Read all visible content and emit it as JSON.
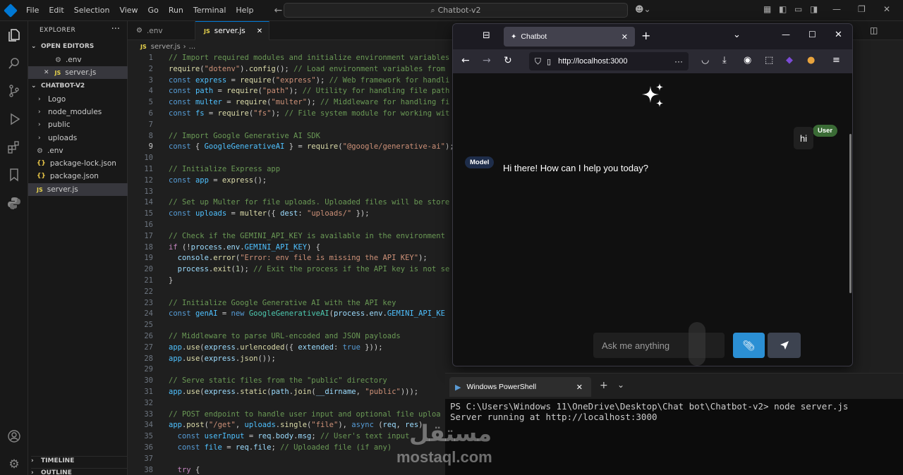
{
  "titlebar": {
    "menus": [
      "File",
      "Edit",
      "Selection",
      "View",
      "Go",
      "Run",
      "Terminal",
      "Help"
    ],
    "search": "Chatbot-v2"
  },
  "sidebar": {
    "title": "EXPLORER",
    "open_editors_label": "OPEN EDITORS",
    "open_editors": [
      ".env",
      "server.js"
    ],
    "project_label": "CHATBOT-V2",
    "folders": [
      "Logo",
      "node_modules",
      "public",
      "uploads"
    ],
    "files": [
      ".env",
      "package-lock.json",
      "package.json",
      "server.js"
    ],
    "timeline_label": "TIMELINE",
    "outline_label": "OUTLINE"
  },
  "editor": {
    "tabs": [
      ".env",
      "server.js"
    ],
    "breadcrumb_file": "server.js",
    "breadcrumb_more": "...",
    "line_numbers": [
      "1",
      "2",
      "3",
      "4",
      "5",
      "6",
      "7",
      "8",
      "9",
      "10",
      "11",
      "12",
      "13",
      "14",
      "15",
      "16",
      "17",
      "18",
      "19",
      "20",
      "21",
      "22",
      "23",
      "24",
      "25",
      "26",
      "27",
      "28",
      "29",
      "30",
      "31",
      "32",
      "33",
      "34",
      "35",
      "36",
      "37",
      "38"
    ]
  },
  "browser": {
    "tab_title": "Chatbot",
    "url": "http://localhost:3000",
    "user_badge": "User",
    "user_message": "hi",
    "model_badge": "Model",
    "model_message": "Hi there! How can I help you today?",
    "input_placeholder": "Ask me anything",
    "colors": {
      "user_badge": "#3a6b35",
      "model_badge": "#1e2d4a",
      "attach_button": "#2b8fd4",
      "send_button": "#3d4350"
    }
  },
  "terminal": {
    "tab_title": "Windows PowerShell",
    "prompt": "PS C:\\Users\\Windows 11\\OneDrive\\Desktop\\Chat bot\\Chatbot-v2>",
    "command": "node server.js",
    "output": "Server running at http://localhost:3000"
  },
  "watermark": {
    "arabic": "مستقل",
    "latin": "mostaql.com"
  }
}
